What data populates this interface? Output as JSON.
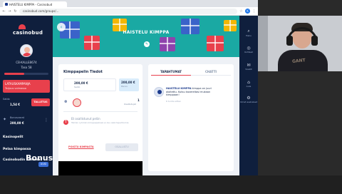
{
  "browser": {
    "tab_title": "HAISTELU KIMPPA - Casinobud",
    "url": "casinobud.com/groups/..."
  },
  "sidebar": {
    "logo": "casinobud",
    "username": "CB-KALLE8674",
    "level": "Taso 58",
    "level_progress": 0.45,
    "promo_title": "LATAUSKAMPANJA",
    "promo_sub": "Tarjous voimassa",
    "balance_label": "Saldo",
    "balance_value": "1,54 €",
    "deposit_label": "TALLETUS",
    "bonus_label": "Bonusvarat",
    "bonus_value": "200,00 €",
    "menu": [
      "Kasinopelit",
      "Pelaa kimpassa",
      "Casinobudin sanomat"
    ],
    "new_badge": "UUSI",
    "overlay_text": "Bonush"
  },
  "banner": {
    "title": "HAISTELU KIMPPA"
  },
  "group_info": {
    "title": "Kimppapelin Tiedot",
    "stat_a_value": "200,00 €",
    "stat_a_label": "Saldo",
    "stat_b_value": "200,00 €",
    "stat_b_label": "Panos",
    "member_count": "1",
    "member_label": "Osallistujat",
    "warning_title": "Et osallistunut peliin",
    "warning_text": "Tämän ryhmän kimppapelissä ei ole vielä tapahtumia",
    "leave_link": "POISTU KIMPASTA",
    "action_button": "OSALLISTU"
  },
  "events": {
    "tab_events": "TAPAHTUMAT",
    "tab_chat": "CHATTI",
    "event_user": "HAISTELU KIMPPA",
    "event_text": " kimppa on juuri aloitettu. Kutsu kavereitasi mukaan kimppaan!",
    "event_time": "6 tuntia sitten"
  },
  "rightbar": {
    "items": [
      "Haku",
      "Kohteet",
      "Viestit",
      "Aula",
      "Omat asetukset"
    ]
  },
  "webcam": {
    "shirt_text": "GANT"
  }
}
